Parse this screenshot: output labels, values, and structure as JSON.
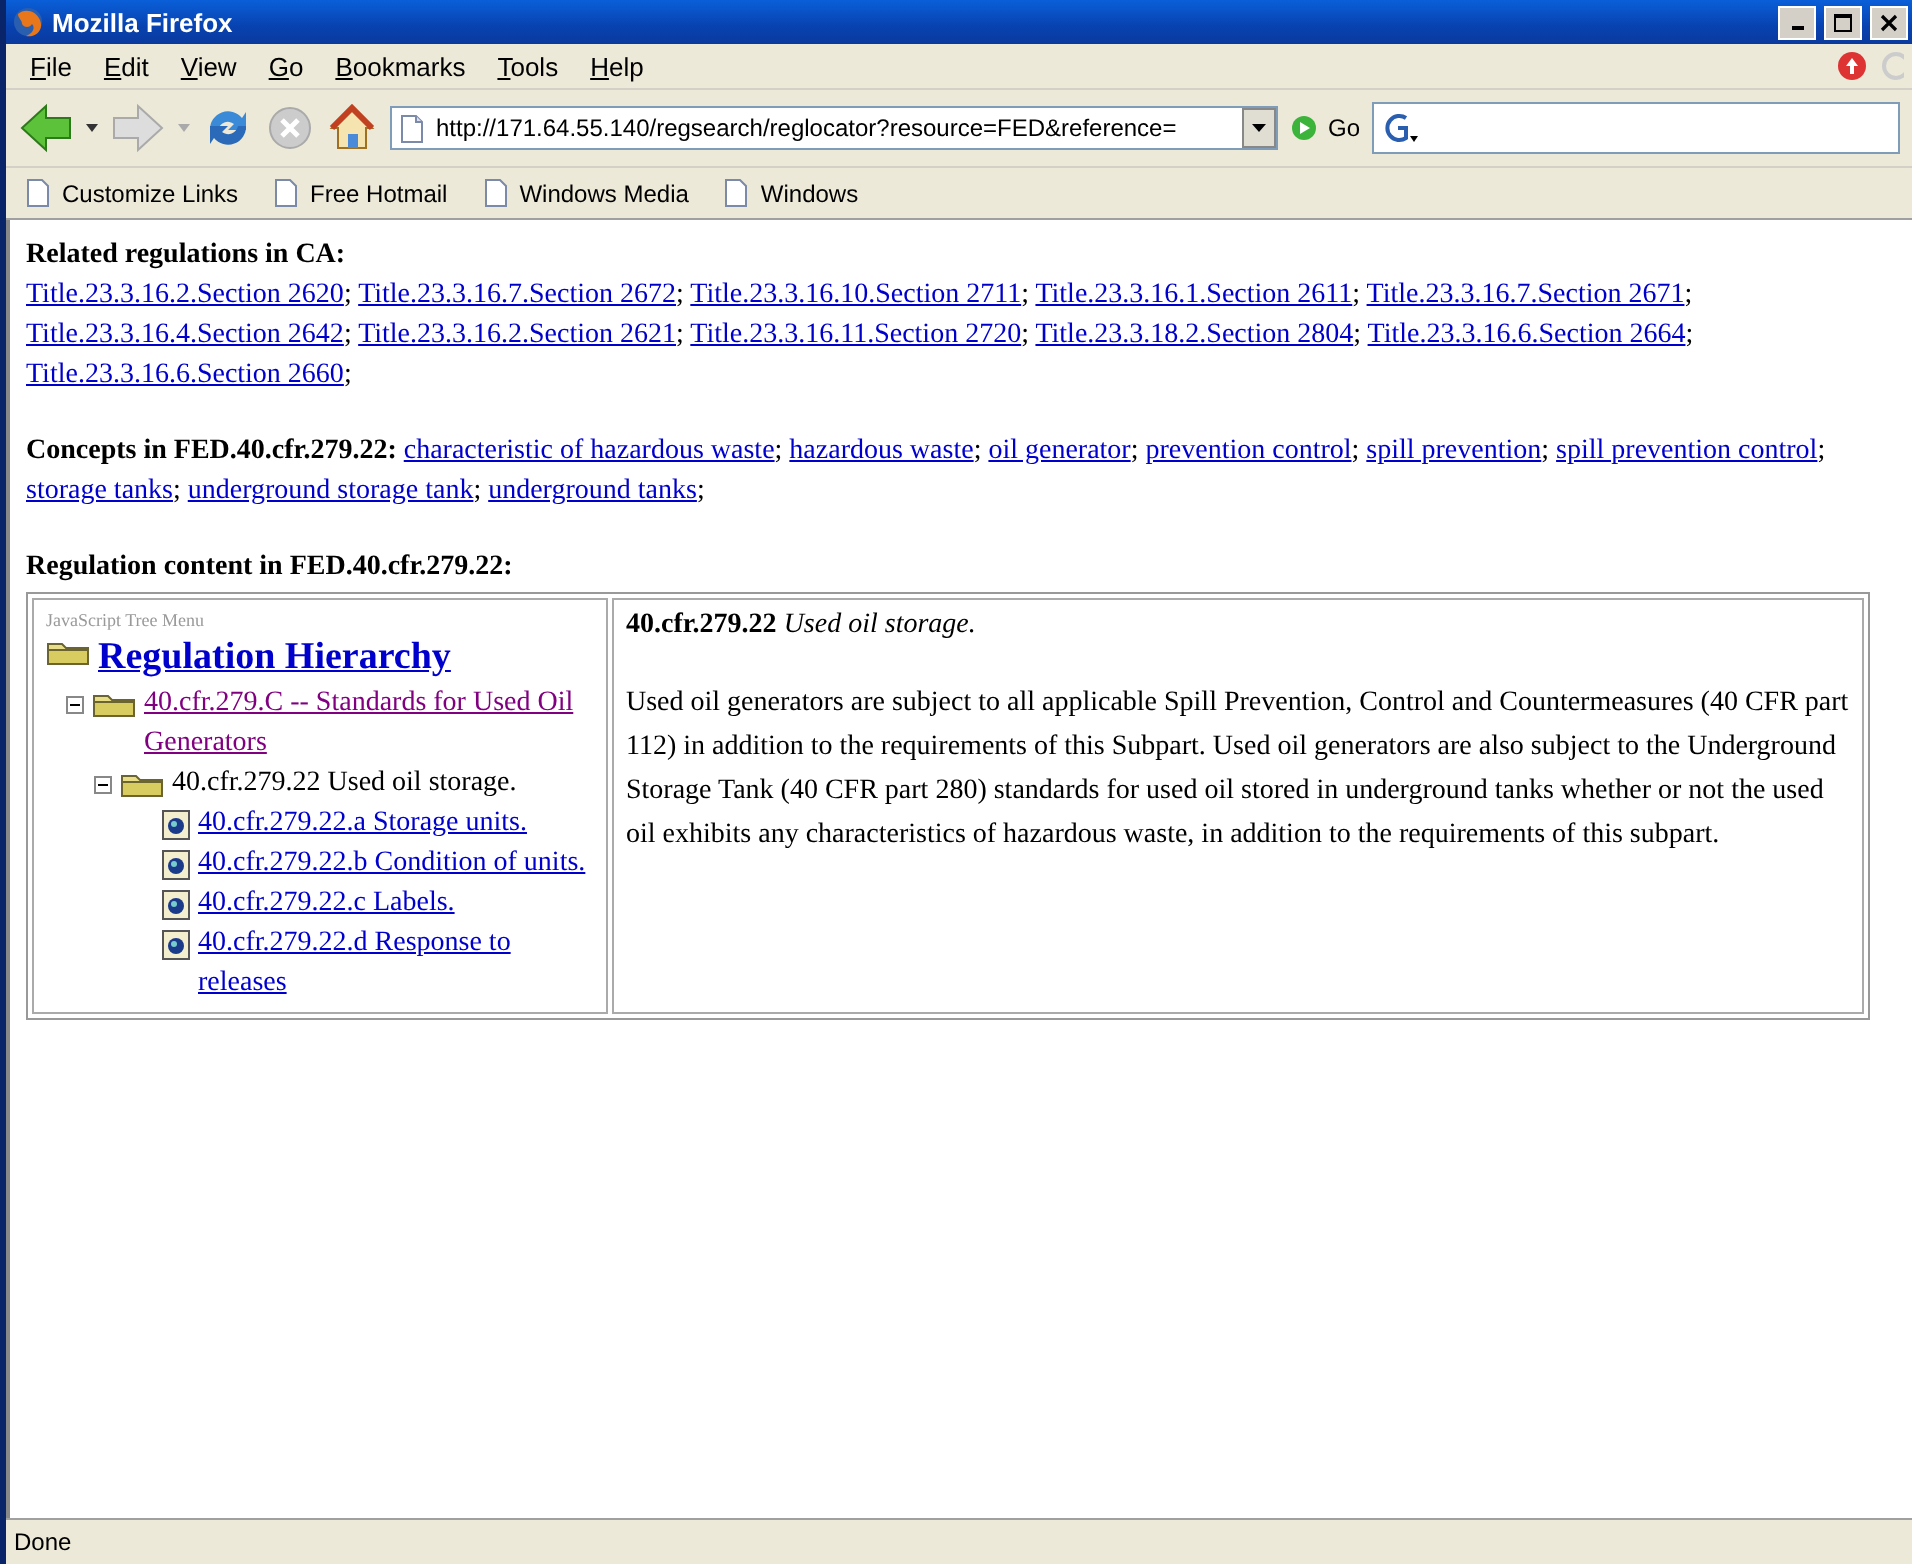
{
  "window": {
    "title": "Mozilla Firefox"
  },
  "menu": [
    "File",
    "Edit",
    "View",
    "Go",
    "Bookmarks",
    "Tools",
    "Help"
  ],
  "nav": {
    "url": "http://171.64.55.140/regsearch/reglocator?resource=FED&reference=",
    "go": "Go"
  },
  "bookmarks": [
    "Customize Links",
    "Free Hotmail",
    "Windows Media",
    "Windows"
  ],
  "separator": ";",
  "related": {
    "heading": "Related regulations in CA:",
    "links": [
      "Title.23.3.16.2.Section 2620",
      "Title.23.3.16.7.Section 2672",
      "Title.23.3.16.10.Section 2711",
      "Title.23.3.16.1.Section 2611",
      "Title.23.3.16.7.Section 2671",
      "Title.23.3.16.4.Section 2642",
      "Title.23.3.16.2.Section 2621",
      "Title.23.3.16.11.Section 2720",
      "Title.23.3.18.2.Section 2804",
      "Title.23.3.16.6.Section 2664",
      "Title.23.3.16.6.Section 2660"
    ]
  },
  "concepts": {
    "heading": "Concepts in FED.40.cfr.279.22:",
    "links": [
      "characteristic of hazardous waste",
      "hazardous waste",
      "oil generator",
      "prevention control",
      "spill prevention",
      "spill prevention control",
      "storage tanks",
      "underground storage tank",
      "underground tanks"
    ]
  },
  "content": {
    "heading": "Regulation content in FED.40.cfr.279.22:",
    "tree_caption": "JavaScript Tree Menu",
    "tree": [
      {
        "kind": "root",
        "label": "Regulation Hierarchy",
        "visited": false,
        "children": [
          {
            "kind": "folder-link",
            "label": "40.cfr.279.C -- Standards for Used Oil Generators",
            "visited": true,
            "expanded": true,
            "children": [
              {
                "kind": "folder",
                "label": "40.cfr.279.22 Used oil storage.",
                "expanded": true,
                "children": [
                  {
                    "kind": "doc",
                    "label": "40.cfr.279.22.a Storage units.",
                    "visited": false
                  },
                  {
                    "kind": "doc",
                    "label": "40.cfr.279.22.b Condition of units.",
                    "visited": false
                  },
                  {
                    "kind": "doc",
                    "label": "40.cfr.279.22.c Labels.",
                    "visited": false
                  },
                  {
                    "kind": "doc",
                    "label": "40.cfr.279.22.d Response to releases",
                    "visited": false
                  }
                ]
              }
            ]
          }
        ]
      }
    ],
    "section_id": "40.cfr.279.22",
    "section_title": "Used oil storage.",
    "body": "Used oil generators are subject to all applicable Spill Prevention, Control and Countermeasures (40 CFR part 112) in addition to the requirements of this Subpart. Used oil generators are also subject to the Underground Storage Tank (40 CFR part 280) standards for used oil stored in underground tanks whether or not the used oil exhibits any characteristics of hazardous waste, in addition to the requirements of this subpart."
  },
  "status_bar": "Done"
}
